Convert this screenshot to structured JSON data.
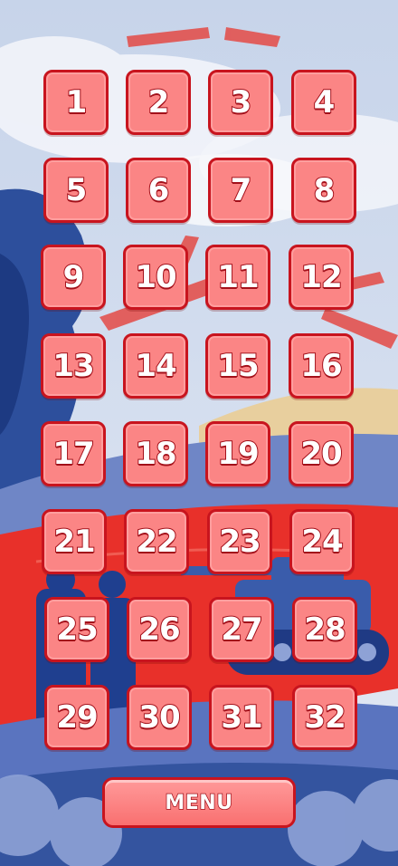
{
  "levels": [
    {
      "label": "1"
    },
    {
      "label": "2"
    },
    {
      "label": "3"
    },
    {
      "label": "4"
    },
    {
      "label": "5"
    },
    {
      "label": "6"
    },
    {
      "label": "7"
    },
    {
      "label": "8"
    },
    {
      "label": "9"
    },
    {
      "label": "10"
    },
    {
      "label": "11"
    },
    {
      "label": "12"
    },
    {
      "label": "13"
    },
    {
      "label": "14"
    },
    {
      "label": "15"
    },
    {
      "label": "16"
    },
    {
      "label": "17"
    },
    {
      "label": "18"
    },
    {
      "label": "19"
    },
    {
      "label": "20"
    },
    {
      "label": "21"
    },
    {
      "label": "22"
    },
    {
      "label": "23"
    },
    {
      "label": "24"
    },
    {
      "label": "25"
    },
    {
      "label": "26"
    },
    {
      "label": "27"
    },
    {
      "label": "28"
    },
    {
      "label": "29"
    },
    {
      "label": "30"
    },
    {
      "label": "31"
    },
    {
      "label": "32"
    }
  ],
  "menu": {
    "label": "MENU"
  },
  "colors": {
    "tile_fill": "#fb8585",
    "tile_border": "#c8141e",
    "sky": "#c9d8ef",
    "field_red": "#e8302a",
    "blue_dark": "#1f3f8f"
  }
}
